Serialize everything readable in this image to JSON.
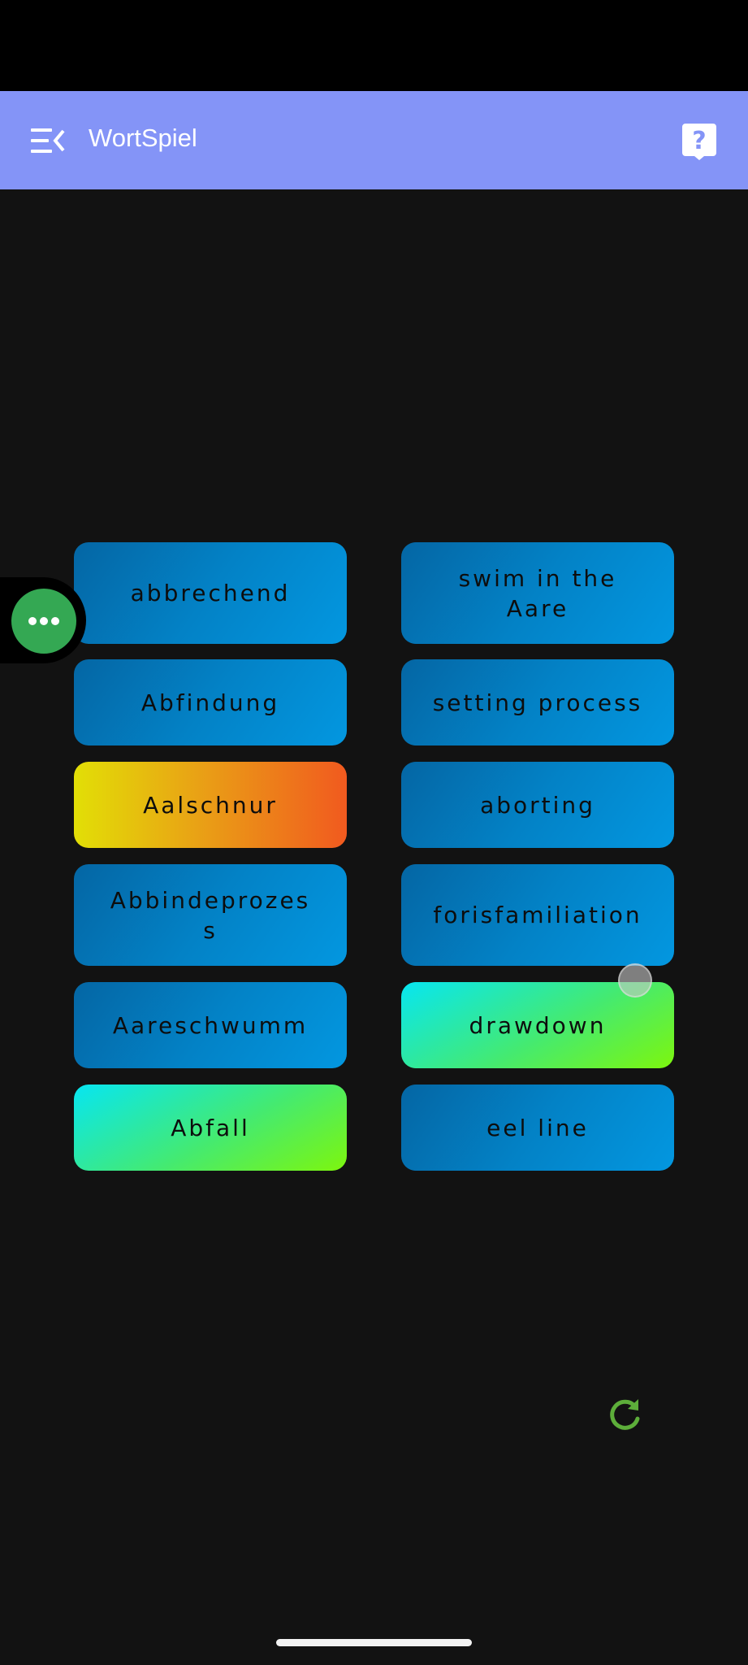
{
  "app": {
    "title": "WortSpiel"
  },
  "icons": {
    "menu": "menu-collapse-icon",
    "help": "help-icon",
    "float": "more-horizontal-icon",
    "refresh": "refresh-icon"
  },
  "colors": {
    "app_bar": "#8494F7",
    "background": "#121212",
    "tile_default": "#0382C6",
    "tile_selected_warm_start": "#E2DF06",
    "tile_selected_warm_end": "#F15A1F",
    "tile_matched_start": "#07E6F2",
    "tile_matched_end": "#7DF60E",
    "refresh": "#5DAE3A",
    "float_button": "#34A853"
  },
  "grid": {
    "left_column": [
      {
        "text": "abbrechend",
        "state": "default"
      },
      {
        "text": "Abfindung",
        "state": "default"
      },
      {
        "text": "Aalschnur",
        "state": "selected"
      },
      {
        "text": "Abbindeprozes s",
        "state": "default"
      },
      {
        "text": "Aareschwumm",
        "state": "default"
      },
      {
        "text": "Abfall",
        "state": "matched"
      }
    ],
    "right_column": [
      {
        "text": "swim in the Aare",
        "state": "default"
      },
      {
        "text": "setting process",
        "state": "default"
      },
      {
        "text": "aborting",
        "state": "default"
      },
      {
        "text": "forisfamiliation",
        "state": "default"
      },
      {
        "text": "drawdown",
        "state": "matched"
      },
      {
        "text": "eel line",
        "state": "default"
      }
    ]
  }
}
